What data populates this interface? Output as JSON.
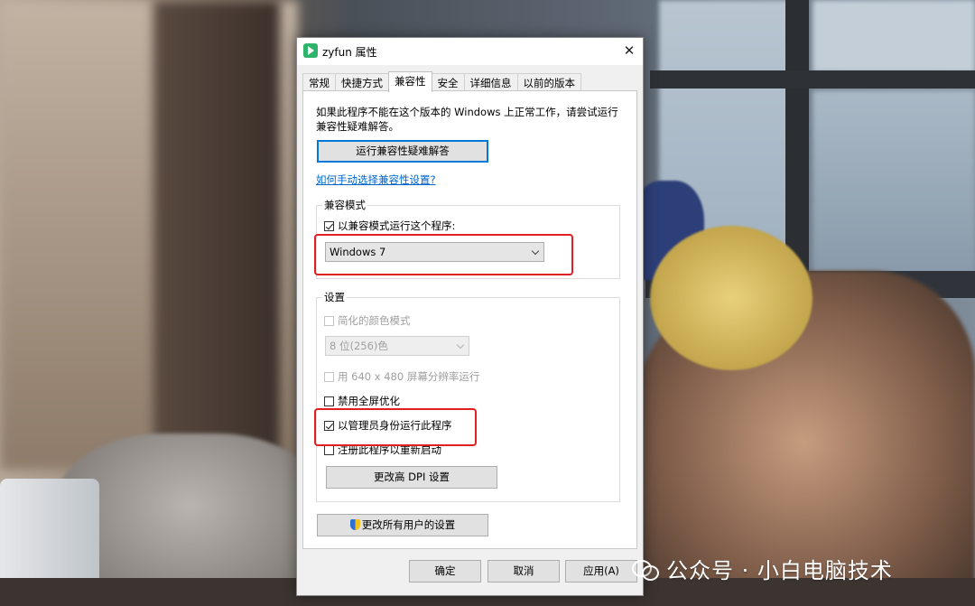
{
  "dialog": {
    "title": "zyfun 属性",
    "close_label": "✕"
  },
  "tabs": [
    {
      "label": "常规",
      "active": false
    },
    {
      "label": "快捷方式",
      "active": false
    },
    {
      "label": "兼容性",
      "active": true
    },
    {
      "label": "安全",
      "active": false
    },
    {
      "label": "详细信息",
      "active": false
    },
    {
      "label": "以前的版本",
      "active": false
    }
  ],
  "compat": {
    "description": "如果此程序不能在这个版本的 Windows 上正常工作，请尝试运行兼容性疑难解答。",
    "troubleshoot_button": "运行兼容性疑难解答",
    "help_link": "如何手动选择兼容性设置?",
    "mode_group": "兼容模式",
    "mode_checkbox": {
      "label": "以兼容模式运行这个程序:",
      "checked": true
    },
    "mode_select": "Windows 7"
  },
  "settings": {
    "group": "设置",
    "reduced_color": {
      "label": "简化的颜色模式",
      "checked": false,
      "disabled": true
    },
    "color_select": "8 位(256)色",
    "res_640": {
      "label": "用 640 x 480 屏幕分辨率运行",
      "checked": false,
      "disabled": true
    },
    "disable_fullscreen": {
      "label": "禁用全屏优化",
      "checked": false
    },
    "run_as_admin": {
      "label": "以管理员身份运行此程序",
      "checked": true
    },
    "register_restart": {
      "label": "注册此程序以重新启动",
      "checked": false
    },
    "dpi_button": "更改高 DPI 设置"
  },
  "all_users_button": "更改所有用户的设置",
  "footer": {
    "ok": "确定",
    "cancel": "取消",
    "apply": "应用(A)"
  },
  "watermark": "公众号 · 小白电脑技术",
  "colors": {
    "highlight": "#e02020",
    "accent": "#0078d7",
    "link": "#0066cc"
  }
}
